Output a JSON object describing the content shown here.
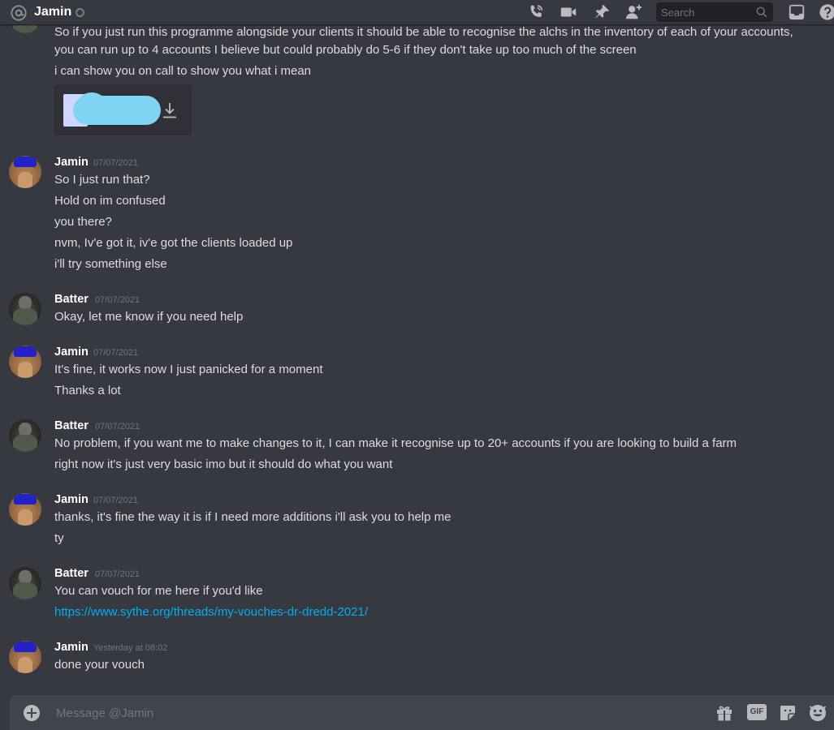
{
  "header": {
    "channel_name": "Jamin",
    "search_placeholder": "Search"
  },
  "messages": [
    {
      "lines": [
        "So if you just run this programme alongside your clients it should be able to recognise the alchs in the inventory of each of your accounts,",
        "you can run up to 4 accounts I believe but could probably do 5-6 if  they don't take up too much of the screen",
        "i can show you on call to show you what i mean"
      ]
    },
    {
      "author": "Jamin",
      "timestamp": "07/07/2021",
      "lines": [
        "So I just run that?",
        "Hold on im confused",
        "you there?",
        "nvm, Iv'e got it, iv'e got the clients loaded up",
        "i'll try something else"
      ]
    },
    {
      "author": "Batter",
      "timestamp": "07/07/2021",
      "lines": [
        "Okay, let me know if you need help"
      ]
    },
    {
      "author": "Jamin",
      "timestamp": "07/07/2021",
      "lines": [
        "It's fine, it works now I just panicked for a moment",
        "Thanks a lot"
      ]
    },
    {
      "author": "Batter",
      "timestamp": "07/07/2021",
      "lines": [
        "No problem, if you want me to make changes to it, I can make it recognise up to 20+ accounts if you are looking to build a farm",
        "right now it's just very basic imo but it should do what you want"
      ]
    },
    {
      "author": "Jamin",
      "timestamp": "07/07/2021",
      "lines": [
        "thanks, it's fine the way it is if I need more additions i'll ask you to help me",
        "ty"
      ]
    },
    {
      "author": "Batter",
      "timestamp": "07/07/2021",
      "lines": [
        "You can vouch for me here if you'd like",
        "https://www.sythe.org/threads/my-vouches-dr-dredd-2021/"
      ]
    },
    {
      "author": "Jamin",
      "timestamp": "Yesterday at 08:02",
      "lines": [
        "done your vouch"
      ]
    }
  ],
  "composer": {
    "placeholder": "Message @Jamin",
    "gif_label": "GIF"
  },
  "icons": {
    "header": [
      "at-icon",
      "call-icon",
      "video-icon",
      "pin-icon",
      "add-friend-icon",
      "search-icon",
      "inbox-icon",
      "help-icon"
    ],
    "composer": [
      "add-attachment-icon",
      "gift-icon",
      "gif-icon",
      "sticker-icon",
      "emoji-icon"
    ],
    "attachment": [
      "download-icon"
    ]
  },
  "colors": {
    "background": "#36393f",
    "text": "#dcddde",
    "muted": "#72767d",
    "link": "#00aff4",
    "composer": "#40444b"
  }
}
